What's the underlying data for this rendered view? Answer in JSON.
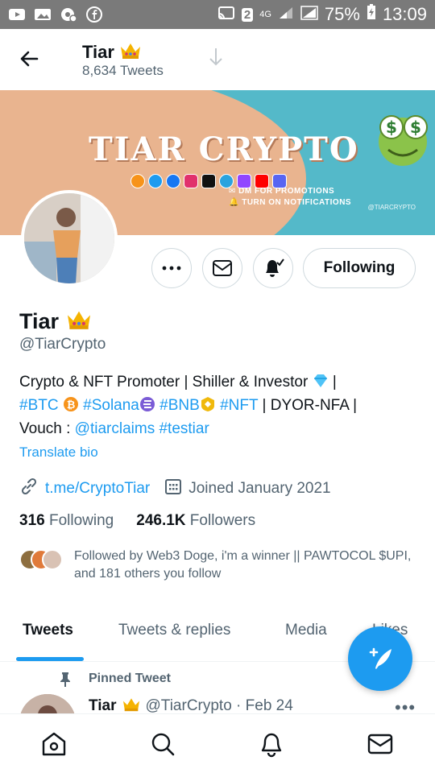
{
  "status_bar": {
    "battery_percent": "75%",
    "time": "13:09",
    "sim": "2",
    "network": "4G"
  },
  "header": {
    "name": "Tiar",
    "tweet_count": "8,634 Tweets"
  },
  "banner": {
    "brand": "TIAR CRYPTO",
    "line1": "✉ DM FOR PROMOTIONS",
    "line2": "🔔 TURN ON NOTIFICATIONS",
    "handle_tag": "@TIARCRYPTO"
  },
  "actions": {
    "following_label": "Following"
  },
  "profile": {
    "name": "Tiar",
    "handle": "@TiarCrypto",
    "bio": {
      "line1_text": "Crypto & NFT Promoter | Shiller & Investor ",
      "line1_end": " |",
      "btc": "#BTC",
      "solana": "#Solana",
      "bnb": "#BNB",
      "nft": "#NFT",
      "line2_tail": " | DYOR-NFA |",
      "vouch_label": "Vouch : ",
      "tiarclaims": "@tiarclaims",
      "testiar": "#testiar"
    },
    "translate": "Translate bio",
    "link": "t.me/CryptoTiar",
    "joined": "Joined January 2021",
    "following_count": "316",
    "following_label": " Following",
    "followers_count": "246.1K",
    "followers_label": " Followers",
    "followed_by": "Followed by Web3 Doge, i'm a winner || PAWTOCOL $UPI, and 181 others you follow"
  },
  "tabs": [
    {
      "label": "Tweets"
    },
    {
      "label": "Tweets & replies"
    },
    {
      "label": "Media"
    },
    {
      "label": "Likes"
    }
  ],
  "pinned": {
    "label": "Pinned Tweet",
    "author": "Tiar",
    "handle_date": "@TiarCrypto · Feb 24",
    "more": "•••"
  },
  "colors": {
    "accent": "#1d9bf0",
    "banner_teal": "#54b9c9",
    "banner_peach": "#e9b48f"
  }
}
